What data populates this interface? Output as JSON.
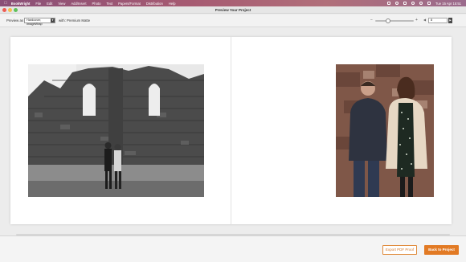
{
  "menubar": {
    "app_name": "BookWright",
    "items": [
      "File",
      "Edit",
      "View",
      "Add/Insert",
      "Photo",
      "Text",
      "Papers/Format",
      "Distribution",
      "Help"
    ],
    "clock": "Tue 15 Apr 15:51"
  },
  "window": {
    "title": "Preview Your Project"
  },
  "toolbar": {
    "preview_as_label": "Preview as",
    "preview_as_value": "Hardcover, ImageWrap",
    "with_label": "with:",
    "paper_name": "Premium Matte",
    "zoom_minus": "−",
    "zoom_plus": "+",
    "zoom_level": 0.33,
    "page_value": "8"
  },
  "buttons": {
    "export_pdf": "Export PDF Proof",
    "back_to_project": "Back to Project"
  },
  "colors": {
    "accent": "#e27a24",
    "menubar_gradient_start": "#8a4f77",
    "menubar_gradient_end": "#9a6a8c"
  }
}
